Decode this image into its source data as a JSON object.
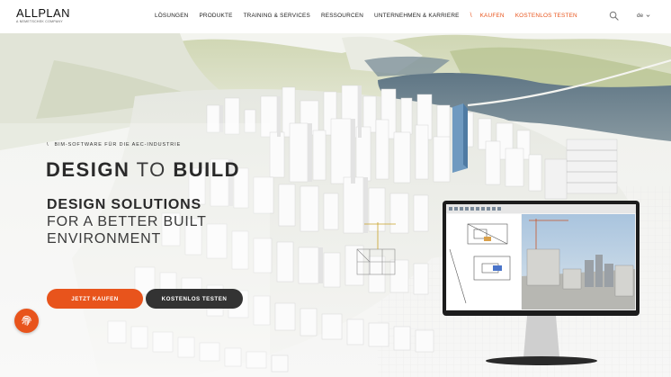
{
  "header": {
    "logo": "ALLPLAN",
    "logo_tagline": "A NEMETSCHEK COMPANY",
    "nav": [
      {
        "label": "LÖSUNGEN"
      },
      {
        "label": "PRODUKTE"
      },
      {
        "label": "TRAINING & SERVICES"
      },
      {
        "label": "RESSOURCEN"
      },
      {
        "label": "UNTERNEHMEN & KARRIERE"
      }
    ],
    "separator": "\\",
    "accent_nav": [
      {
        "label": "KAUFEN"
      },
      {
        "label": "KOSTENLOS TESTEN"
      }
    ],
    "language": "de",
    "icons": {
      "search": "search-icon",
      "language_dropdown": "chevron-down-icon"
    }
  },
  "hero": {
    "eyebrow_mark": "\\",
    "eyebrow": "BIM-SOFTWARE FÜR DIE AEC-INDUSTRIE",
    "headline_part1": "DESIGN",
    "headline_to": "TO",
    "headline_part2": "BUILD",
    "subheadline_line1": "DESIGN SOLUTIONS",
    "subheadline_line2": "FOR A BETTER BUILT",
    "subheadline_line3": "ENVIRONMENT",
    "primary_button": "JETZT KAUFEN",
    "secondary_button": "KOSTENLOS TESTEN",
    "fab_icon": "fingerprint-icon"
  },
  "colors": {
    "accent": "#e8541c",
    "dark_button": "#333333",
    "text": "#2a2a2a",
    "background": "#ffffff"
  }
}
